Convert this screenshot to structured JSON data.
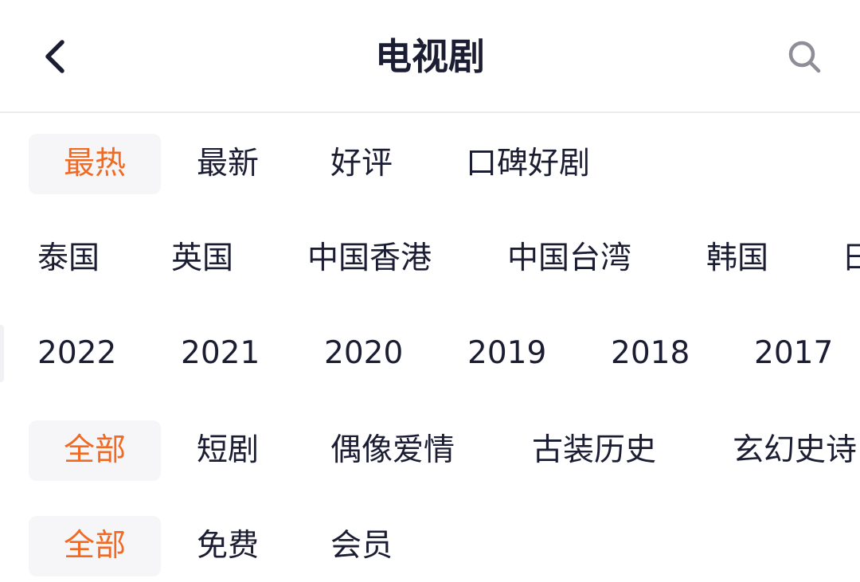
{
  "header": {
    "title": "电视剧",
    "back_icon": "chevron-left-icon",
    "search_icon": "search-icon"
  },
  "colors": {
    "accent": "#f06a24",
    "text": "#1b1d33",
    "chip_bg": "#f6f6f8",
    "icon_gray": "#8e8e96"
  },
  "filters": {
    "sort": {
      "selected": "最热",
      "options": [
        "最热",
        "最新",
        "好评",
        "口碑好剧"
      ]
    },
    "region": {
      "options": [
        "泰国",
        "英国",
        "中国香港",
        "中国台湾",
        "韩国",
        "日"
      ]
    },
    "year": {
      "options": [
        "2022",
        "2021",
        "2020",
        "2019",
        "2018",
        "2017"
      ]
    },
    "genre": {
      "selected": "全部",
      "options": [
        "全部",
        "短剧",
        "偶像爱情",
        "古装历史",
        "玄幻史诗"
      ]
    },
    "pay": {
      "selected": "全部",
      "options": [
        "全部",
        "免费",
        "会员"
      ]
    }
  }
}
